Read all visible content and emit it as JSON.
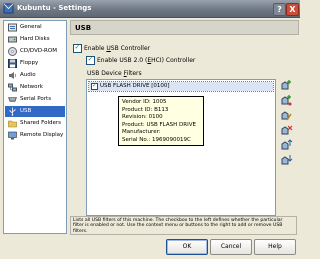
{
  "window": {
    "title": "Kubuntu - Settings",
    "help_label": "?",
    "close_label": "X"
  },
  "sidebar": {
    "items": [
      {
        "label": "General",
        "icon": "general-icon"
      },
      {
        "label": "Hard Disks",
        "icon": "hard-disk-icon"
      },
      {
        "label": "CD/DVD-ROM",
        "icon": "cd-icon"
      },
      {
        "label": "Floppy",
        "icon": "floppy-icon"
      },
      {
        "label": "Audio",
        "icon": "speaker-icon"
      },
      {
        "label": "Network",
        "icon": "network-icon"
      },
      {
        "label": "Serial Ports",
        "icon": "serial-port-icon"
      },
      {
        "label": "USB",
        "icon": "usb-icon",
        "selected": true
      },
      {
        "label": "Shared Folders",
        "icon": "folder-icon"
      },
      {
        "label": "Remote Display",
        "icon": "monitor-icon"
      }
    ]
  },
  "page": {
    "heading": "USB",
    "enable_usb": {
      "prefix": "Enable ",
      "accel": "U",
      "suffix": "SB Controller",
      "checked": true
    },
    "enable_usb2": {
      "prefix": "Enable USB 2.0 (",
      "accel": "E",
      "suffix": "HCI) Controller",
      "checked": true
    },
    "filters_label": {
      "prefix": "USB Device ",
      "accel": "F",
      "suffix": "ilters"
    },
    "filters": [
      {
        "label": "USB FLASH DRIVE [0100]",
        "checked": true
      }
    ],
    "tooltip": [
      "Vendor ID: 1005",
      "Product ID: B113",
      "Revision: 0100",
      "Product: USB FLASH DRIVE",
      "Manufacturer:",
      "Serial No.: 1969090019C"
    ],
    "description": "Lists all USB filters of this machine. The checkbox to the left defines whether the particular filter is enabled or not. Use the context menu or buttons to the right to add or remove USB filters."
  },
  "side_buttons": [
    {
      "icon": "add-filter-icon"
    },
    {
      "icon": "add-from-device-icon"
    },
    {
      "icon": "edit-filter-icon"
    },
    {
      "icon": "remove-filter-icon"
    },
    {
      "icon": "move-up-icon"
    },
    {
      "icon": "move-down-icon"
    }
  ],
  "buttons": {
    "ok": "OK",
    "cancel": "Cancel",
    "help": "Help"
  },
  "colors": {
    "selection": "#316ac5",
    "tooltip_bg": "#ffffe1",
    "title_bar": "#6f7985"
  }
}
